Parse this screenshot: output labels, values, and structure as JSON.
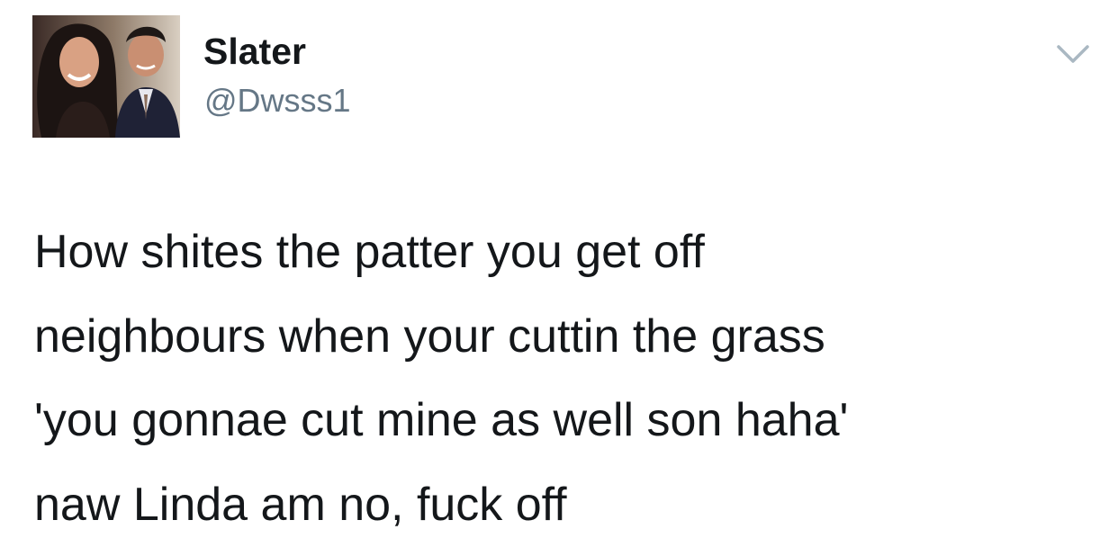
{
  "tweet": {
    "author": {
      "display_name": "Slater",
      "handle": "@Dwsss1",
      "avatar_icon": "profile-photo"
    },
    "menu_icon": "chevron-down-icon",
    "text_lines": [
      "How shites the patter you get off",
      "neighbours when your cuttin the grass",
      "'you gonnae cut mine as well son haha'",
      "naw Linda am no, fuck off"
    ]
  },
  "colors": {
    "background": "#ffffff",
    "text": "#14171a",
    "secondary_text": "#657786",
    "caret": "#aab8c2"
  }
}
